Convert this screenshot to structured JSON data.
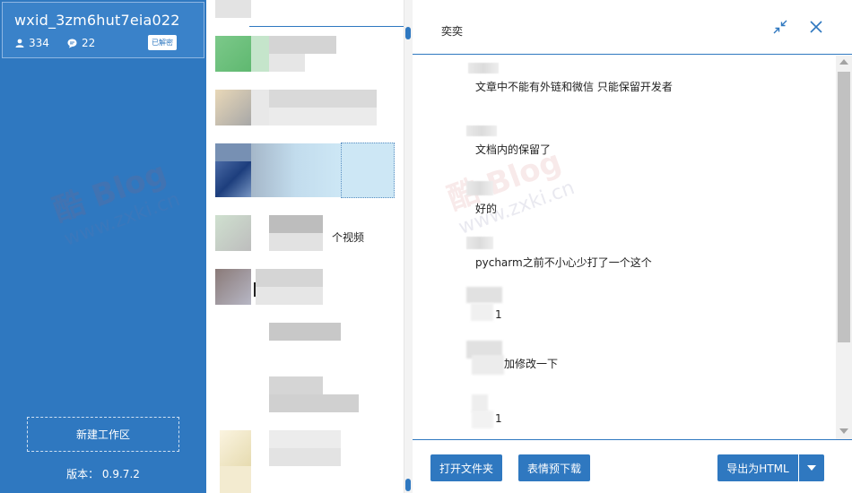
{
  "account": {
    "name": "wxid_3zm6hut7eia022",
    "users_count": "334",
    "chats_count": "22",
    "badge": "已解密"
  },
  "sidebar": {
    "new_workspace": "新建工作区",
    "version": "版本： 0.9.7.2"
  },
  "list": {
    "snippet": "个视频"
  },
  "chat": {
    "title": "奕奕",
    "messages": [
      {
        "text": "文章中不能有外链和微信 只能保留开发者"
      },
      {
        "text": "文档内的保留了"
      },
      {
        "text": "好的"
      },
      {
        "text": "pycharm之前不小心少打了一个这个"
      },
      {
        "text": "1"
      },
      {
        "text": "加修改一下"
      },
      {
        "text": "1"
      }
    ]
  },
  "footer": {
    "open_folder": "打开文件夹",
    "emoji_download": "表情预下载",
    "export_html": "导出为HTML"
  },
  "watermark": {
    "logo": "酷 Blog",
    "site": "www.zxki.cn"
  },
  "colors": {
    "accent": "#2f78c0",
    "selected_row": "#cde7f5"
  }
}
